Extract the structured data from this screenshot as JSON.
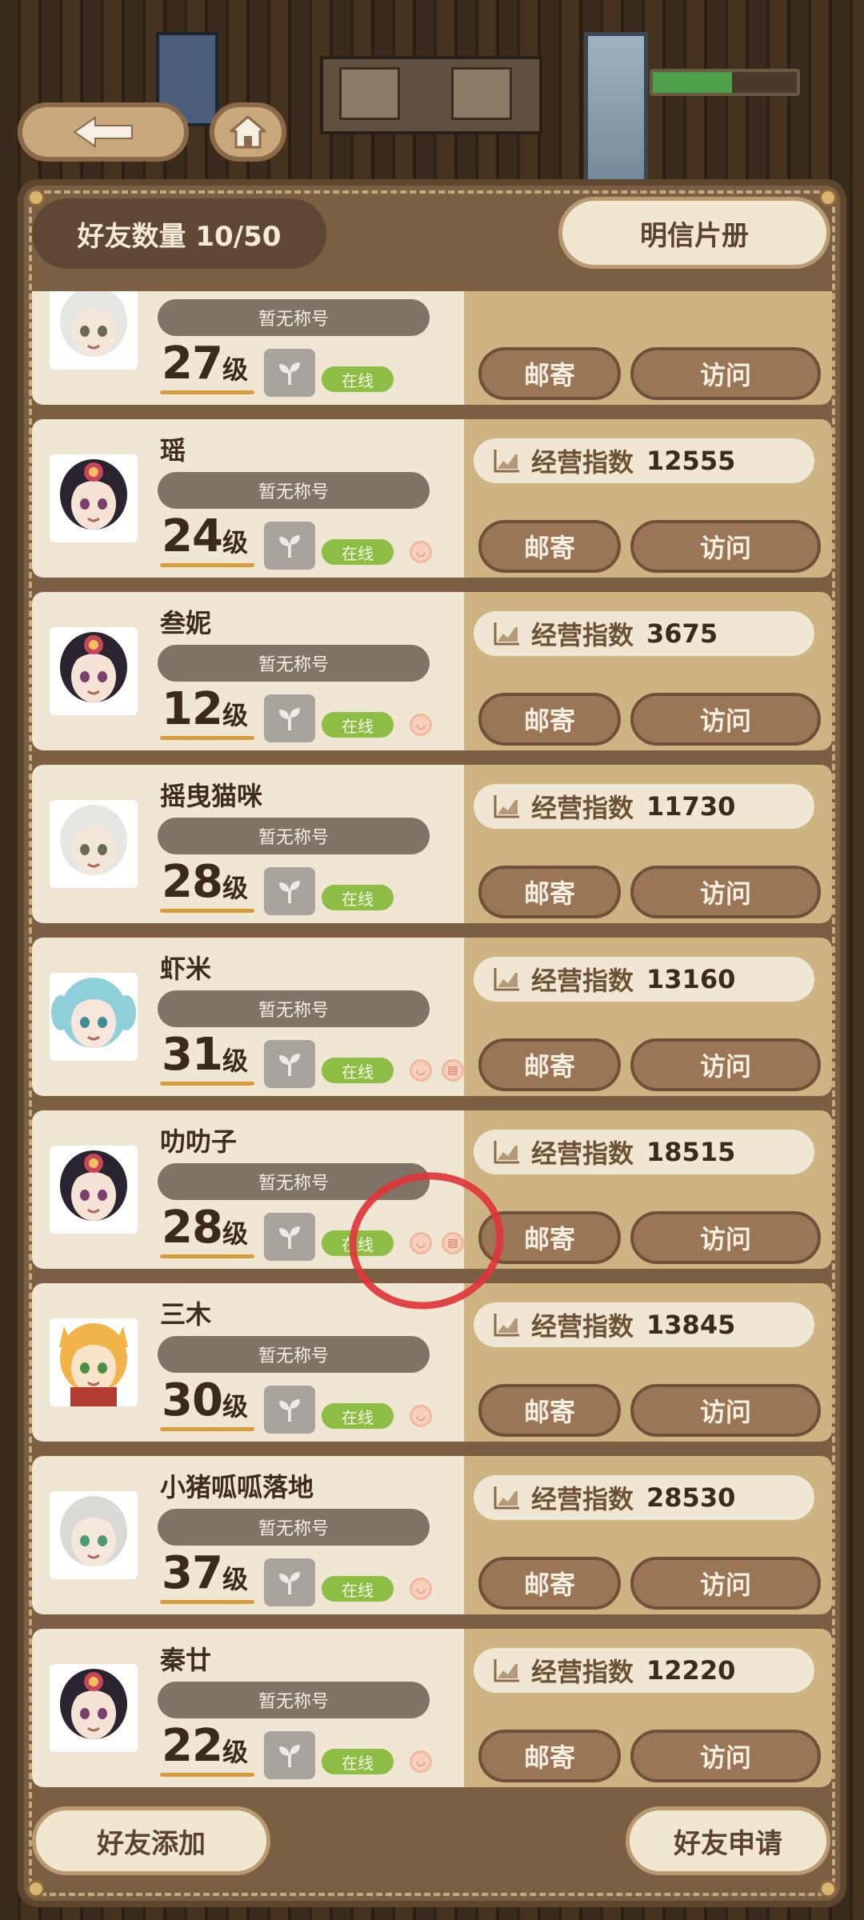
{
  "header": {
    "friend_count": "好友数量 10/50",
    "postcard_album": "明信片册",
    "back_icon": "back-arrow-icon",
    "home_icon": "home-icon",
    "progress": 0.55
  },
  "labels": {
    "no_title": "暂无称号",
    "level_unit": "级",
    "online": "在线",
    "score_label": "经营指数",
    "mail": "邮寄",
    "visit": "访问"
  },
  "friends": [
    {
      "name": "",
      "level": "27",
      "score": "",
      "badges": 0,
      "avatar": "white-hair"
    },
    {
      "name": "瑶",
      "level": "24",
      "score": "12555",
      "badges": 1,
      "avatar": "dark-hair"
    },
    {
      "name": "叁妮",
      "level": "12",
      "score": "3675",
      "badges": 1,
      "avatar": "dark-hair"
    },
    {
      "name": "摇曳猫咪",
      "level": "28",
      "score": "11730",
      "badges": 0,
      "avatar": "white-hair"
    },
    {
      "name": "虾米",
      "level": "31",
      "score": "13160",
      "badges": 2,
      "avatar": "blue-hair"
    },
    {
      "name": "叻叻子",
      "level": "28",
      "score": "18515",
      "badges": 2,
      "avatar": "dark-hair"
    },
    {
      "name": "三木",
      "level": "30",
      "score": "13845",
      "badges": 1,
      "avatar": "fox"
    },
    {
      "name": "小猪呱呱落地",
      "level": "37",
      "score": "28530",
      "badges": 1,
      "avatar": "silver-hair"
    },
    {
      "name": "秦廿",
      "level": "22",
      "score": "12220",
      "badges": 1,
      "avatar": "dark-hair"
    }
  ],
  "footer": {
    "add_friend": "好友添加",
    "friend_requests": "好友申请"
  }
}
